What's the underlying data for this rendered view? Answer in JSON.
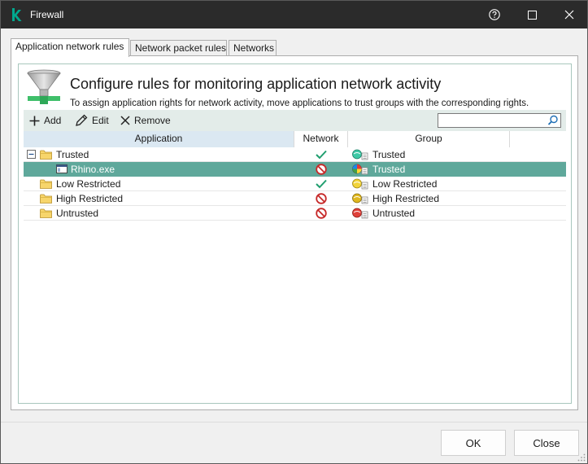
{
  "window": {
    "title": "Firewall"
  },
  "tabs": [
    {
      "label": "Application network rules",
      "active": true
    },
    {
      "label": "Network packet rules",
      "active": false
    },
    {
      "label": "Networks",
      "active": false
    }
  ],
  "header": {
    "heading": "Configure rules for monitoring application network activity",
    "description": "To assign application rights for network activity, move applications to trust groups with the corresponding rights."
  },
  "toolbar": {
    "add_label": "Add",
    "edit_label": "Edit",
    "remove_label": "Remove",
    "search_value": "",
    "search_placeholder": ""
  },
  "table": {
    "columns": [
      "Application",
      "Network",
      "Group"
    ],
    "rows": [
      {
        "application": "Trusted",
        "kind": "folder",
        "expanded": true,
        "network": "allowed",
        "group": "Trusted",
        "group_icon": "trusted-icon",
        "selected": false
      },
      {
        "application": "Rhino.exe",
        "kind": "application",
        "network": "blocked",
        "group": "Trusted",
        "group_icon": "trusted-multicolor-icon",
        "selected": true
      },
      {
        "application": "Low Restricted",
        "kind": "folder",
        "network": "allowed",
        "group": "Low Restricted",
        "group_icon": "low-restricted-icon",
        "selected": false
      },
      {
        "application": "High Restricted",
        "kind": "folder",
        "network": "blocked",
        "group": "High Restricted",
        "group_icon": "high-restricted-icon",
        "selected": false
      },
      {
        "application": "Untrusted",
        "kind": "folder",
        "network": "blocked",
        "group": "Untrusted",
        "group_icon": "untrusted-icon",
        "selected": false
      }
    ]
  },
  "buttons": {
    "ok_label": "OK",
    "close_label": "Close"
  },
  "colors": {
    "titlebar": "#2b2b2b",
    "accent": "#00a88e",
    "selection": "#5fa89b",
    "allowed": "#1f9e6e",
    "blocked": "#c62828"
  }
}
